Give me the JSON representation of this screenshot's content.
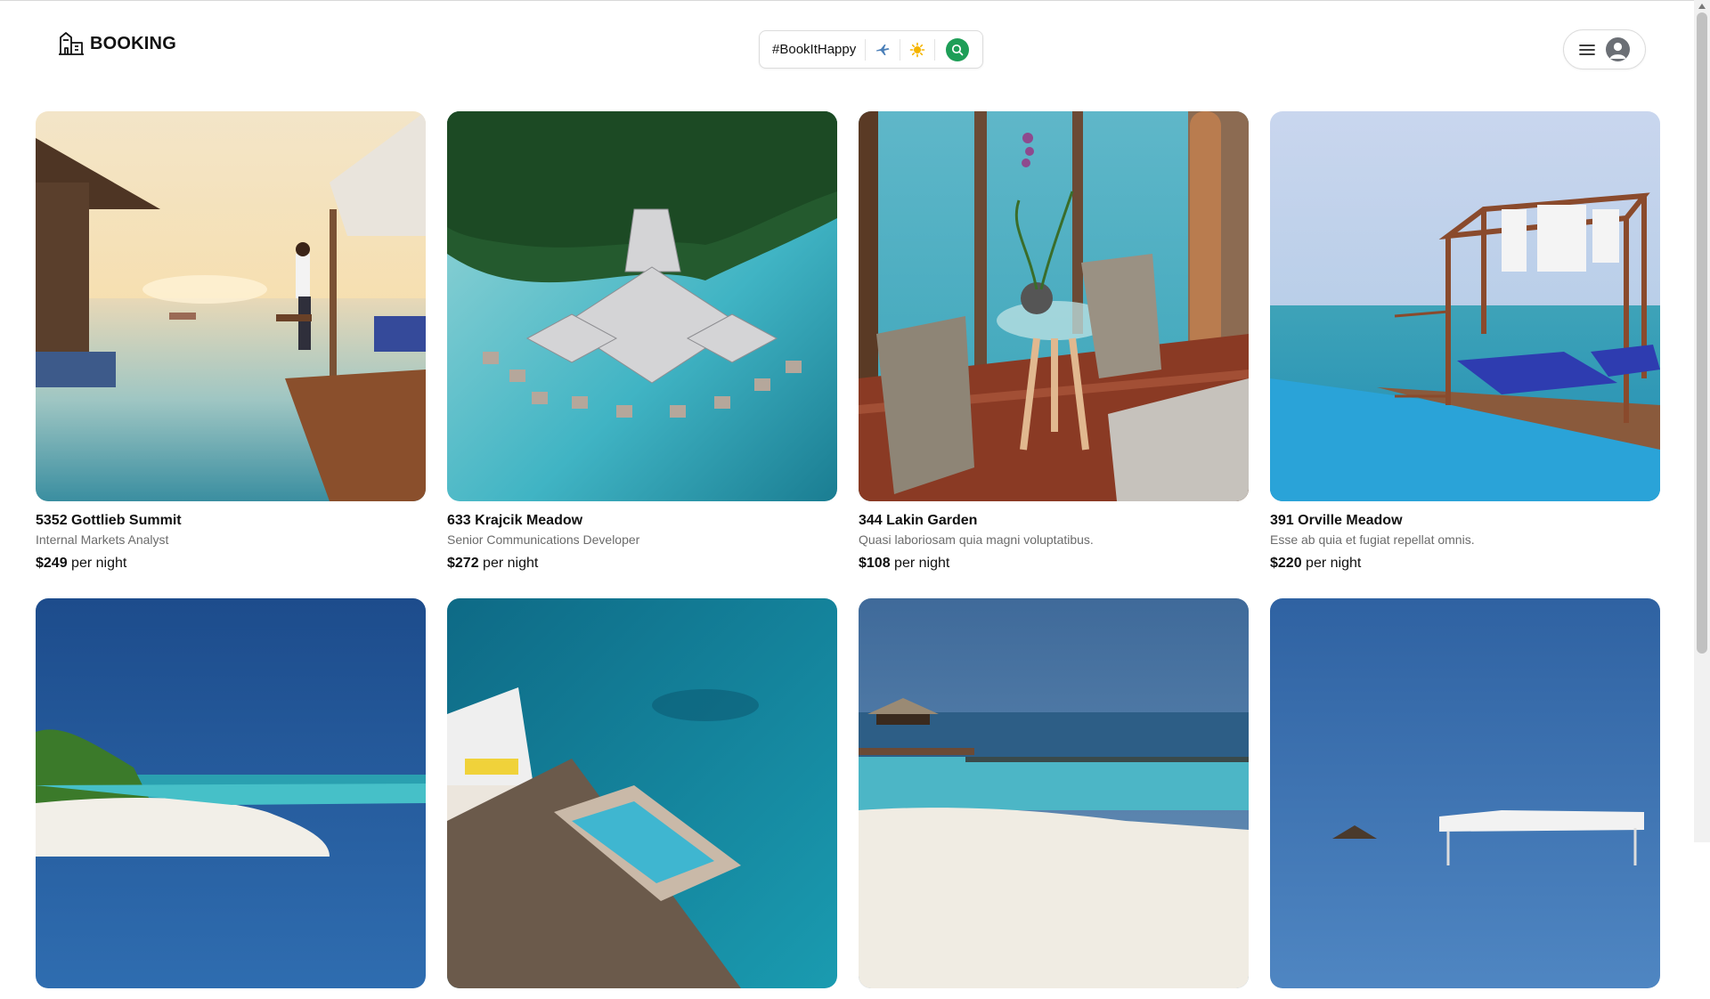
{
  "header": {
    "brand": "BOOKING",
    "search": {
      "tag": "#BookItHappy",
      "icons": [
        "airplane-icon",
        "sun-icon",
        "search-icon"
      ]
    },
    "menu_icons": [
      "hamburger-icon",
      "user-avatar-icon"
    ]
  },
  "colors": {
    "accent": "#1e9e57",
    "text": "#111111",
    "muted": "#6b6b6b"
  },
  "listings": [
    {
      "title": "5352 Gottlieb Summit",
      "subtitle": "Internal Markets Analyst",
      "price": "$249",
      "price_suffix": "per night"
    },
    {
      "title": "633 Krajcik Meadow",
      "subtitle": "Senior Communications Developer",
      "price": "$272",
      "price_suffix": "per night"
    },
    {
      "title": "344 Lakin Garden",
      "subtitle": "Quasi laboriosam quia magni voluptatibus.",
      "price": "$108",
      "price_suffix": "per night"
    },
    {
      "title": "391 Orville Meadow",
      "subtitle": "Esse ab quia et fugiat repellat omnis.",
      "price": "$220",
      "price_suffix": "per night"
    },
    {
      "title": "",
      "subtitle": "",
      "price": "",
      "price_suffix": ""
    },
    {
      "title": "",
      "subtitle": "",
      "price": "",
      "price_suffix": ""
    },
    {
      "title": "",
      "subtitle": "",
      "price": "",
      "price_suffix": ""
    },
    {
      "title": "",
      "subtitle": "",
      "price": "",
      "price_suffix": ""
    }
  ]
}
